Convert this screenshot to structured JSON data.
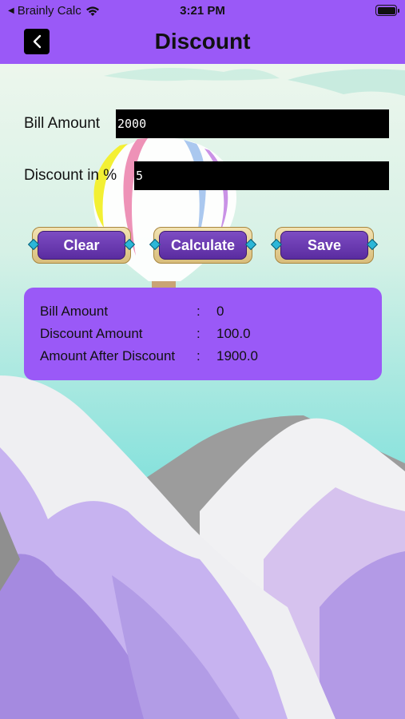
{
  "status_bar": {
    "carrier": "Brainly Calc",
    "time": "3:21 PM"
  },
  "header": {
    "title": "Discount",
    "back_icon": "chevron-left-icon",
    "color": "#9a59f7"
  },
  "form": {
    "bill_amount_label": "Bill Amount",
    "bill_amount_value": "2000",
    "discount_label": "Discount in %",
    "discount_value": "5"
  },
  "buttons": {
    "clear": "Clear",
    "calculate": "Calculate",
    "save": "Save"
  },
  "results": {
    "rows": [
      {
        "label": "Bill Amount",
        "sep": ":",
        "value": "0"
      },
      {
        "label": "Discount Amount",
        "sep": ":",
        "value": "100.0"
      },
      {
        "label": "Amount After Discount",
        "sep": ":",
        "value": "1900.0"
      }
    ],
    "color": "#9a59f7"
  }
}
